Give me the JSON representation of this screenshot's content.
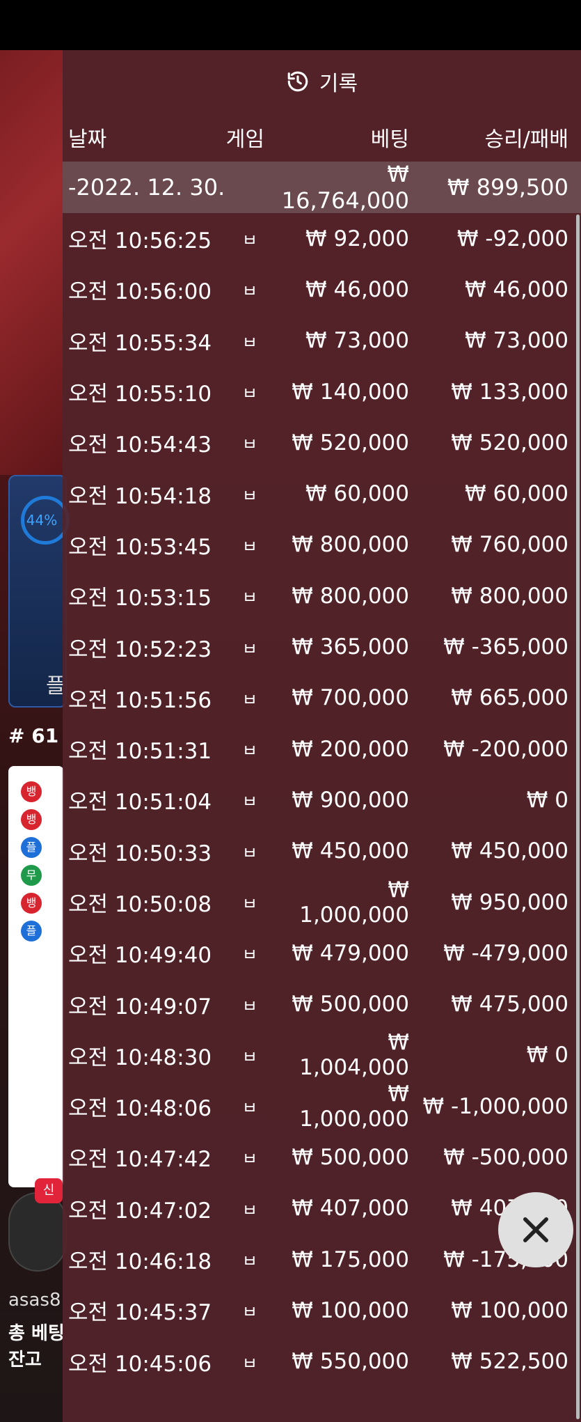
{
  "background": {
    "percent": "44%",
    "player_label": "플",
    "round": "# 61",
    "new_badge": "신",
    "user_name": "asas8",
    "total_bet_label": "총 베팅",
    "balance_label": "잔고"
  },
  "history": {
    "title": "기록",
    "columns": {
      "date": "날짜",
      "game": "게임",
      "bet": "베팅",
      "result": "승리/패배"
    },
    "summary": {
      "date": "-2022. 12. 30.",
      "bet": "₩ 16,764,000",
      "result": "₩ 899,500"
    },
    "rows": [
      {
        "time": "오전 10:56:25",
        "game": "ㅂ",
        "bet": "₩ 92,000",
        "result": "₩ -92,000"
      },
      {
        "time": "오전 10:56:00",
        "game": "ㅂ",
        "bet": "₩ 46,000",
        "result": "₩ 46,000"
      },
      {
        "time": "오전 10:55:34",
        "game": "ㅂ",
        "bet": "₩ 73,000",
        "result": "₩ 73,000"
      },
      {
        "time": "오전 10:55:10",
        "game": "ㅂ",
        "bet": "₩ 140,000",
        "result": "₩ 133,000"
      },
      {
        "time": "오전 10:54:43",
        "game": "ㅂ",
        "bet": "₩ 520,000",
        "result": "₩ 520,000"
      },
      {
        "time": "오전 10:54:18",
        "game": "ㅂ",
        "bet": "₩ 60,000",
        "result": "₩ 60,000"
      },
      {
        "time": "오전 10:53:45",
        "game": "ㅂ",
        "bet": "₩ 800,000",
        "result": "₩ 760,000"
      },
      {
        "time": "오전 10:53:15",
        "game": "ㅂ",
        "bet": "₩ 800,000",
        "result": "₩ 800,000"
      },
      {
        "time": "오전 10:52:23",
        "game": "ㅂ",
        "bet": "₩ 365,000",
        "result": "₩ -365,000"
      },
      {
        "time": "오전 10:51:56",
        "game": "ㅂ",
        "bet": "₩ 700,000",
        "result": "₩ 665,000"
      },
      {
        "time": "오전 10:51:31",
        "game": "ㅂ",
        "bet": "₩ 200,000",
        "result": "₩ -200,000"
      },
      {
        "time": "오전 10:51:04",
        "game": "ㅂ",
        "bet": "₩ 900,000",
        "result": "₩ 0"
      },
      {
        "time": "오전 10:50:33",
        "game": "ㅂ",
        "bet": "₩ 450,000",
        "result": "₩ 450,000"
      },
      {
        "time": "오전 10:50:08",
        "game": "ㅂ",
        "bet": "₩ 1,000,000",
        "result": "₩ 950,000"
      },
      {
        "time": "오전 10:49:40",
        "game": "ㅂ",
        "bet": "₩ 479,000",
        "result": "₩ -479,000"
      },
      {
        "time": "오전 10:49:07",
        "game": "ㅂ",
        "bet": "₩ 500,000",
        "result": "₩ 475,000"
      },
      {
        "time": "오전 10:48:30",
        "game": "ㅂ",
        "bet": "₩ 1,004,000",
        "result": "₩ 0"
      },
      {
        "time": "오전 10:48:06",
        "game": "ㅂ",
        "bet": "₩ 1,000,000",
        "result": "₩ -1,000,000"
      },
      {
        "time": "오전 10:47:42",
        "game": "ㅂ",
        "bet": "₩ 500,000",
        "result": "₩ -500,000"
      },
      {
        "time": "오전 10:47:02",
        "game": "ㅂ",
        "bet": "₩ 407,000",
        "result": "₩ 407,000"
      },
      {
        "time": "오전 10:46:18",
        "game": "ㅂ",
        "bet": "₩ 175,000",
        "result": "₩ -175,000"
      },
      {
        "time": "오전 10:45:37",
        "game": "ㅂ",
        "bet": "₩ 100,000",
        "result": "₩ 100,000"
      },
      {
        "time": "오전 10:45:06",
        "game": "ㅂ",
        "bet": "₩ 550,000",
        "result": "₩ 522,500"
      }
    ]
  },
  "icons": {
    "history": "history-clock-icon",
    "close": "close-icon"
  }
}
